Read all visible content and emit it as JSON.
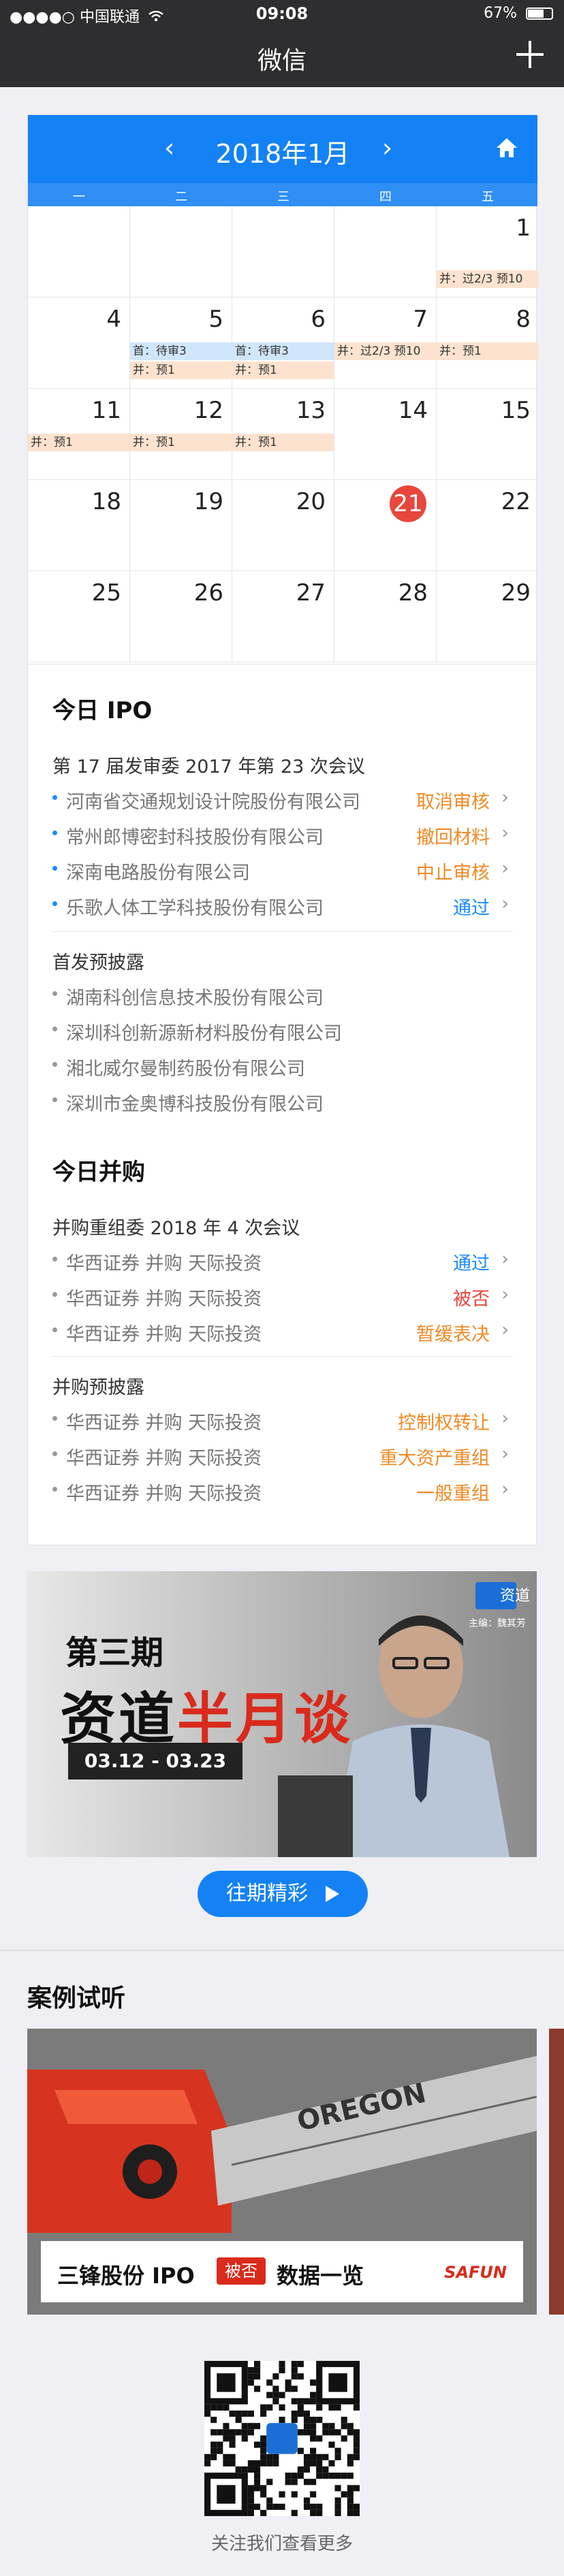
{
  "status_bar": {
    "carrier": "●●●●○ 中国联通",
    "wifi_icon": "wifi-icon",
    "time": "09:08",
    "battery": "67%",
    "battery_level": 0.67
  },
  "nav": {
    "title": "微信",
    "add_icon": "plus-icon"
  },
  "calendar": {
    "prev": "‹",
    "next": "›",
    "month": "2018年1月",
    "home_icon": "home-icon",
    "weekdays": [
      "一",
      "二",
      "三",
      "四",
      "五"
    ],
    "days": [
      {
        "num": "",
        "tags": []
      },
      {
        "num": "",
        "tags": []
      },
      {
        "num": "",
        "tags": []
      },
      {
        "num": "",
        "tags": []
      },
      {
        "num": "1",
        "tags": [
          {
            "text": "并：过2/3 预10",
            "color": "orange",
            "slot": 1
          }
        ]
      },
      {
        "num": "4",
        "tags": []
      },
      {
        "num": "5",
        "tags": [
          {
            "text": "首：待审3",
            "color": "blue",
            "slot": 0
          },
          {
            "text": "并：预1",
            "color": "orange",
            "slot": 1
          }
        ]
      },
      {
        "num": "6",
        "tags": [
          {
            "text": "首：待审3",
            "color": "blue",
            "slot": 0
          },
          {
            "text": "并：预1",
            "color": "orange",
            "slot": 1
          }
        ]
      },
      {
        "num": "7",
        "tags": [
          {
            "text": "并：过2/3 预10",
            "color": "orange",
            "slot": 0
          }
        ]
      },
      {
        "num": "8",
        "tags": [
          {
            "text": "并：预1",
            "color": "orange",
            "slot": 0
          }
        ]
      },
      {
        "num": "11",
        "tags": [
          {
            "text": "并：预1",
            "color": "orange",
            "slot": 0
          }
        ]
      },
      {
        "num": "12",
        "tags": [
          {
            "text": "并：预1",
            "color": "orange",
            "slot": 0
          }
        ]
      },
      {
        "num": "13",
        "tags": [
          {
            "text": "并：预1",
            "color": "orange",
            "slot": 0
          }
        ]
      },
      {
        "num": "14",
        "tags": []
      },
      {
        "num": "15",
        "tags": []
      },
      {
        "num": "18",
        "tags": []
      },
      {
        "num": "19",
        "tags": []
      },
      {
        "num": "20",
        "tags": []
      },
      {
        "num": "21",
        "tags": [],
        "today": true
      },
      {
        "num": "22",
        "tags": []
      },
      {
        "num": "25",
        "tags": []
      },
      {
        "num": "26",
        "tags": []
      },
      {
        "num": "27",
        "tags": []
      },
      {
        "num": "28",
        "tags": []
      },
      {
        "num": "29",
        "tags": []
      }
    ]
  },
  "ipo": {
    "title": "今日 IPO",
    "meeting": "第 17 届发审委 2017 年第 23 次会议",
    "items": [
      {
        "name": "河南省交通规划设计院股份有限公司",
        "status": "取消审核",
        "color": "orange"
      },
      {
        "name": "常州郎博密封科技股份有限公司",
        "status": "撤回材料",
        "color": "orange"
      },
      {
        "name": "深南电路股份有限公司",
        "status": "中止审核",
        "color": "orange"
      },
      {
        "name": "乐歌人体工学科技股份有限公司",
        "status": "通过",
        "color": "blue"
      }
    ],
    "disclosure_title": "首发预披露",
    "disclosure": [
      "湖南科创信息技术股份有限公司",
      "深圳科创新源新材料股份有限公司",
      "湘北威尔曼制药股份有限公司",
      "深圳市金奥博科技股份有限公司"
    ]
  },
  "ma": {
    "title": "今日并购",
    "meeting": "并购重组委 2018 年 4 次会议",
    "items": [
      {
        "name": "华西证券 并购 天际投资",
        "status": "通过",
        "color": "blue"
      },
      {
        "name": "华西证券 并购 天际投资",
        "status": "被否",
        "color": "red"
      },
      {
        "name": "华西证券 并购 天际投资",
        "status": "暂缓表决",
        "color": "orange"
      }
    ],
    "disclosure_title": "并购预披露",
    "disclosure": [
      {
        "name": "华西证券 并购 天际投资",
        "status": "控制权转让",
        "color": "orange"
      },
      {
        "name": "华西证券 并购 天际投资",
        "status": "重大资产重组",
        "color": "orange"
      },
      {
        "name": "华西证券 并购 天际投资",
        "status": "一般重组",
        "color": "orange"
      }
    ]
  },
  "banner": {
    "line1": "第三期",
    "line2a": "资道",
    "line2b": "半月谈",
    "dates": "03.12 - 03.23",
    "logo": "资道",
    "host": "主编：魏其芳"
  },
  "more_button": "往期精彩",
  "cases": {
    "title": "案例试听",
    "caption_a": "三锋股份 IPO",
    "caption_badge": "被否",
    "caption_b": "数据一览",
    "caption_logo": "SAFUN"
  },
  "footer": {
    "qr_caption": "关注我们查看更多"
  }
}
